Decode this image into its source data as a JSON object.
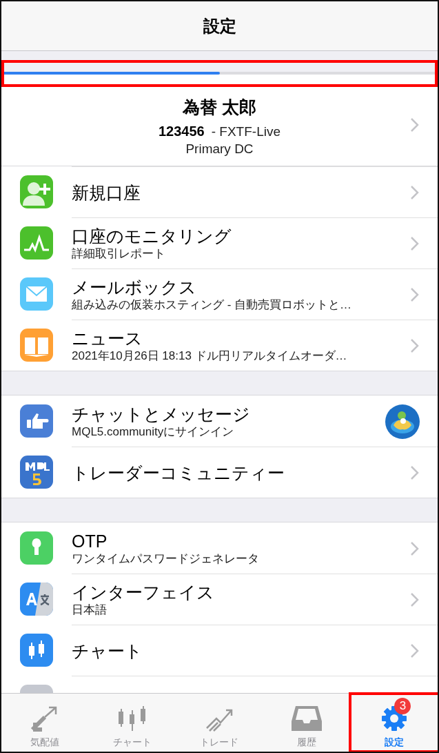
{
  "header": {
    "title": "設定"
  },
  "progress": {
    "level": 0.5,
    "highlighted": true
  },
  "account": {
    "name": "為替 太郎",
    "number": "123456",
    "server": "- FXTF-Live",
    "datacenter": "Primary DC"
  },
  "sections": [
    {
      "items": [
        {
          "kind": "chevron",
          "title": "新規口座"
        },
        {
          "kind": "chevron",
          "title": "口座のモニタリング",
          "subtitle": "詳細取引レポート"
        },
        {
          "kind": "chevron",
          "title": "メールボックス",
          "subtitle": "組み込みの仮装ホスティング - 自動売買ロボットと…"
        },
        {
          "kind": "chevron",
          "title": "ニュース",
          "subtitle": "2021年10月26日 18:13 ドル円リアルタイムオーダ…"
        }
      ]
    },
    {
      "items": [
        {
          "kind": "avatar",
          "title": "チャットとメッセージ",
          "subtitle": "MQL5.communityにサインイン"
        },
        {
          "kind": "chevron",
          "title": "トレーダーコミュニティー"
        }
      ]
    },
    {
      "items": [
        {
          "kind": "chevron",
          "title": "OTP",
          "subtitle": "ワンタイムパスワードジェネレータ"
        },
        {
          "kind": "chevron",
          "title": "インターフェイス",
          "subtitle": "日本語"
        },
        {
          "kind": "chevron",
          "title": "チャート"
        },
        {
          "kind": "cut"
        }
      ]
    }
  ],
  "tabs": [
    {
      "label": "気配値",
      "selected": false,
      "highlighted": false
    },
    {
      "label": "チャート",
      "selected": false,
      "highlighted": false
    },
    {
      "label": "トレード",
      "selected": false,
      "highlighted": false
    },
    {
      "label": "履歴",
      "selected": false,
      "highlighted": false
    },
    {
      "label": "設定",
      "selected": true,
      "highlighted": true,
      "badge": "3"
    }
  ]
}
